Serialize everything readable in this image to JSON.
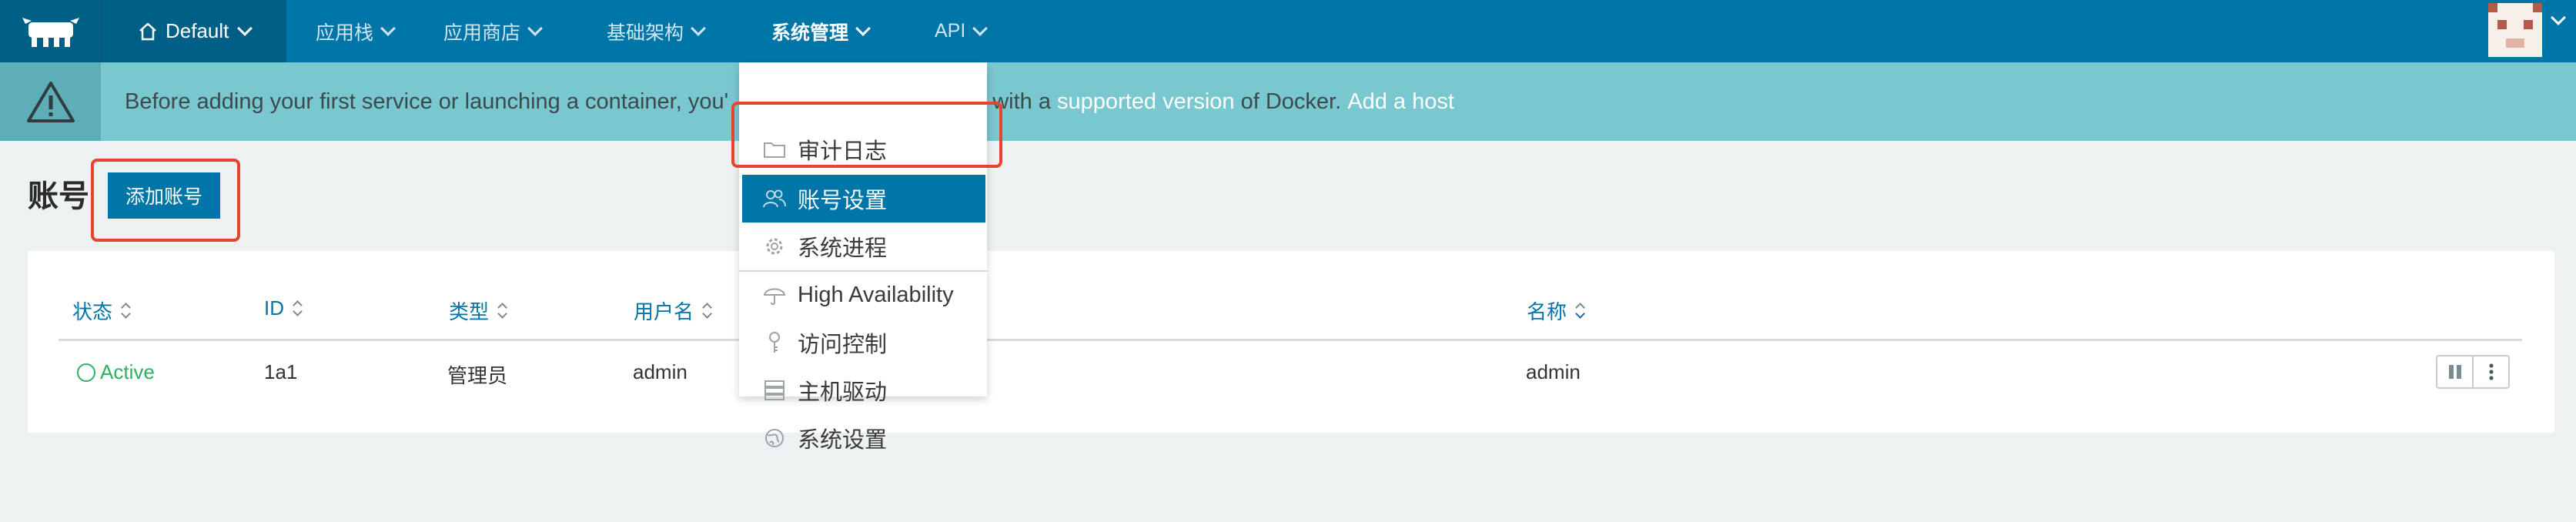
{
  "topnav": {
    "environment": "Default",
    "items": [
      {
        "label": "应用栈"
      },
      {
        "label": "应用商店"
      },
      {
        "label": "基础架构"
      },
      {
        "label": "系统管理"
      },
      {
        "label": "API"
      }
    ]
  },
  "banner": {
    "text_before": "Before adding your first service or launching a container, you'",
    "text_middle": " with a ",
    "link_supported": "supported version",
    "text_after": " of Docker. ",
    "link_add_host": "Add a host"
  },
  "page": {
    "title": "账号",
    "add_button": "添加账号"
  },
  "table": {
    "columns": [
      "状态",
      "ID",
      "类型",
      "用户名",
      "名称"
    ],
    "rows": [
      {
        "status": "Active",
        "id": "1a1",
        "type": "管理员",
        "username": "admin",
        "name": "admin"
      }
    ]
  },
  "dropdown": {
    "items": [
      {
        "label": "审计日志",
        "icon": "folder-icon"
      },
      {
        "label": "账号设置",
        "icon": "users-icon"
      },
      {
        "label": "系统进程",
        "icon": "gear-icon"
      },
      {
        "label": "High Availability",
        "icon": "umbrella-icon"
      },
      {
        "label": "访问控制",
        "icon": "key-icon"
      },
      {
        "label": "主机驱动",
        "icon": "server-icon"
      },
      {
        "label": "系统设置",
        "icon": "globe-icon"
      }
    ]
  },
  "colors": {
    "nav_bg": "#0075a8",
    "nav_dark": "#005f87",
    "banner_bg": "#79c7cf",
    "active_status": "#2faf60",
    "highlight": "#e8432f"
  }
}
